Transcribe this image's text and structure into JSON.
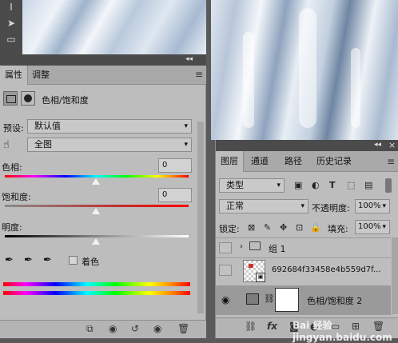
{
  "toolbar": {
    "tools": [
      "text-tool-icon",
      "move-tool-icon",
      "marquee-tool-icon"
    ]
  },
  "properties": {
    "collapse": "◂◂",
    "tabs": [
      {
        "label": "属性"
      },
      {
        "label": "调整"
      }
    ],
    "header_title": "色相/饱和度",
    "preset_label": "预设:",
    "preset_value": "默认值",
    "channel_value": "全图",
    "hue_label": "色相:",
    "hue_value": "0",
    "saturation_label": "饱和度:",
    "saturation_value": "0",
    "lightness_label": "明度:",
    "lightness_value": "0",
    "colorize_label": "着色"
  },
  "layers": {
    "collapse": "◂◂",
    "close": "×",
    "tabs": [
      {
        "label": "图层"
      },
      {
        "label": "通道"
      },
      {
        "label": "路径"
      },
      {
        "label": "历史记录"
      }
    ],
    "filter_kind": "类型",
    "blend_mode": "正常",
    "opacity_label": "不透明度:",
    "opacity_value": "100%",
    "lock_label": "锁定:",
    "fill_label": "填充:",
    "fill_value": "100%",
    "items": [
      {
        "name": "组 1"
      },
      {
        "name": "692684f33458e4b559d7f..."
      },
      {
        "name": "色相/饱和度 2"
      }
    ]
  },
  "watermark": "Bai 经验 jingyan.baidu.com"
}
